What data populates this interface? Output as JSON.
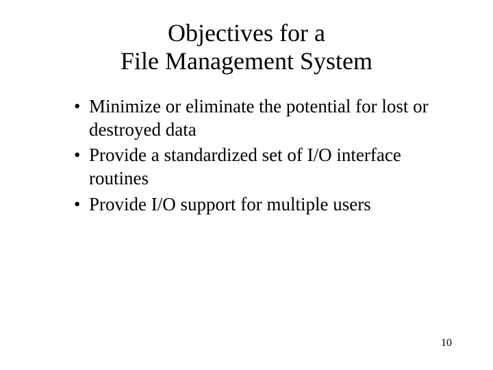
{
  "title_line1": "Objectives for a",
  "title_line2": "File Management System",
  "bullets": {
    "0": "Minimize or eliminate the potential for lost or destroyed data",
    "1": "Provide a standardized set of I/O interface routines",
    "2": "Provide I/O support for multiple users"
  },
  "page_number": "10"
}
